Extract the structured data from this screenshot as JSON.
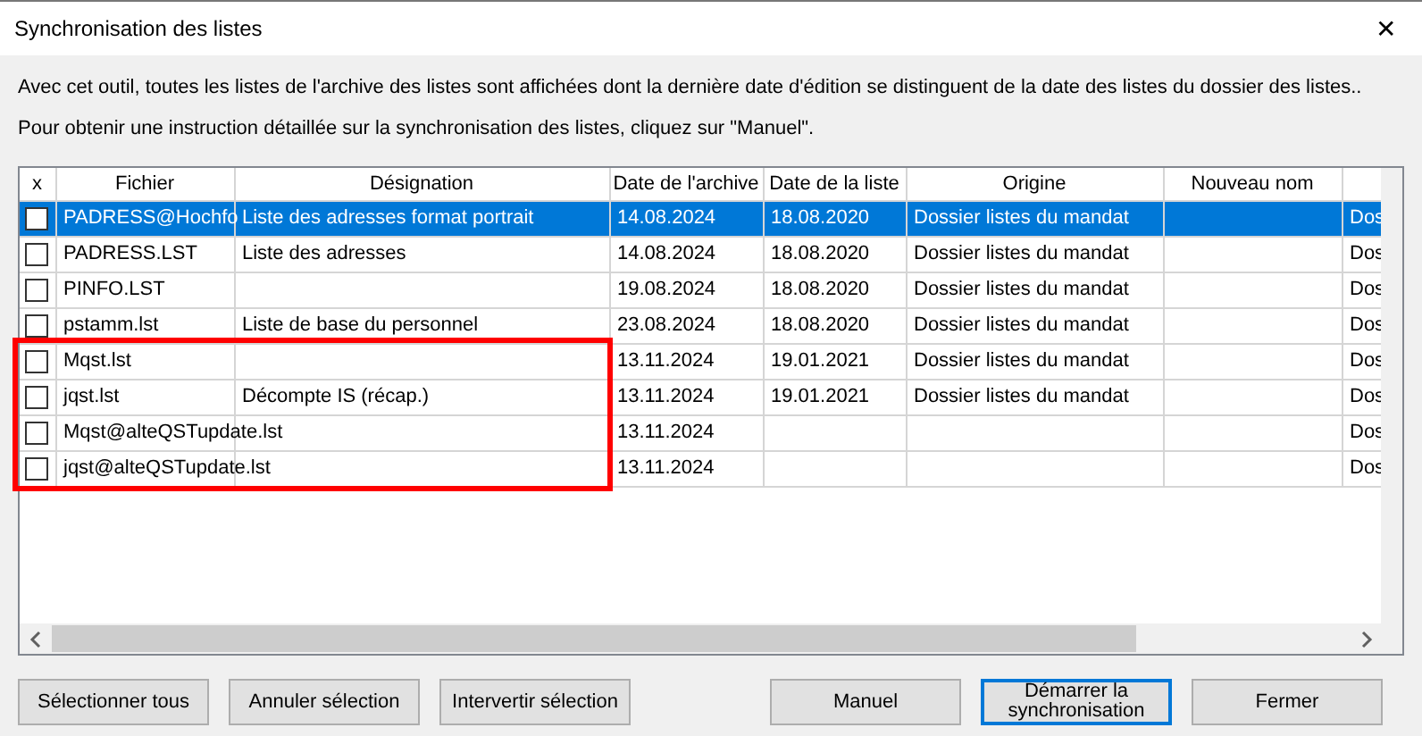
{
  "window": {
    "title": "Synchronisation des listes",
    "close": "✕"
  },
  "intro": [
    "Avec cet outil, toutes les listes de l'archive des listes sont affichées dont la dernière date d'édition se distinguent de la date des listes du dossier des listes..",
    "Pour obtenir une instruction détaillée sur la synchronisation des listes, cliquez sur \"Manuel\"."
  ],
  "table": {
    "check_column": "x",
    "columns": [
      "Fichier",
      "Désignation",
      "Date de l'archive",
      "Date de la liste",
      "Origine",
      "Nouveau nom"
    ],
    "rows": [
      {
        "checked": false,
        "selected": true,
        "highlighted": false,
        "cells": [
          "PADRESS@Hochfo",
          "Liste des adresses format portrait",
          "14.08.2024",
          "18.08.2020",
          "Dossier listes du mandat",
          "",
          "Dos"
        ]
      },
      {
        "checked": false,
        "selected": false,
        "highlighted": false,
        "cells": [
          "PADRESS.LST",
          "Liste des adresses",
          "14.08.2024",
          "18.08.2020",
          "Dossier listes du mandat",
          "",
          "Dos"
        ]
      },
      {
        "checked": false,
        "selected": false,
        "highlighted": false,
        "cells": [
          "PINFO.LST",
          "",
          "19.08.2024",
          "18.08.2020",
          "Dossier listes du mandat",
          "",
          "Dos"
        ]
      },
      {
        "checked": false,
        "selected": false,
        "highlighted": false,
        "cells": [
          "pstamm.lst",
          "Liste de base du personnel",
          "23.08.2024",
          "18.08.2020",
          "Dossier listes du mandat",
          "",
          "Dos"
        ]
      },
      {
        "checked": false,
        "selected": false,
        "highlighted": true,
        "cells": [
          "Mqst.lst",
          "",
          "13.11.2024",
          "19.01.2021",
          "Dossier listes du mandat",
          "",
          "Dos"
        ]
      },
      {
        "checked": false,
        "selected": false,
        "highlighted": true,
        "cells": [
          "jqst.lst",
          "Décompte IS (récap.)",
          "13.11.2024",
          "19.01.2021",
          "Dossier listes du mandat",
          "",
          "Dos"
        ]
      },
      {
        "checked": false,
        "selected": false,
        "highlighted": true,
        "cells": [
          "Mqst@alteQSTupdate.lst",
          "",
          "13.11.2024",
          "",
          "",
          "",
          "Dos"
        ]
      },
      {
        "checked": false,
        "selected": false,
        "highlighted": true,
        "cells": [
          "jqst@alteQSTupdate.lst",
          "",
          "13.11.2024",
          "",
          "",
          "",
          "Dos"
        ]
      }
    ]
  },
  "buttons_left": [
    {
      "label": "Sélectionner tous",
      "focused": false
    },
    {
      "label": "Annuler sélection",
      "focused": false
    },
    {
      "label": "Intervertir sélection",
      "focused": false
    }
  ],
  "buttons_right": [
    {
      "label": "Manuel",
      "focused": false
    },
    {
      "label": "Démarrer la synchronisation",
      "focused": true
    },
    {
      "label": "Fermer",
      "focused": false
    }
  ]
}
